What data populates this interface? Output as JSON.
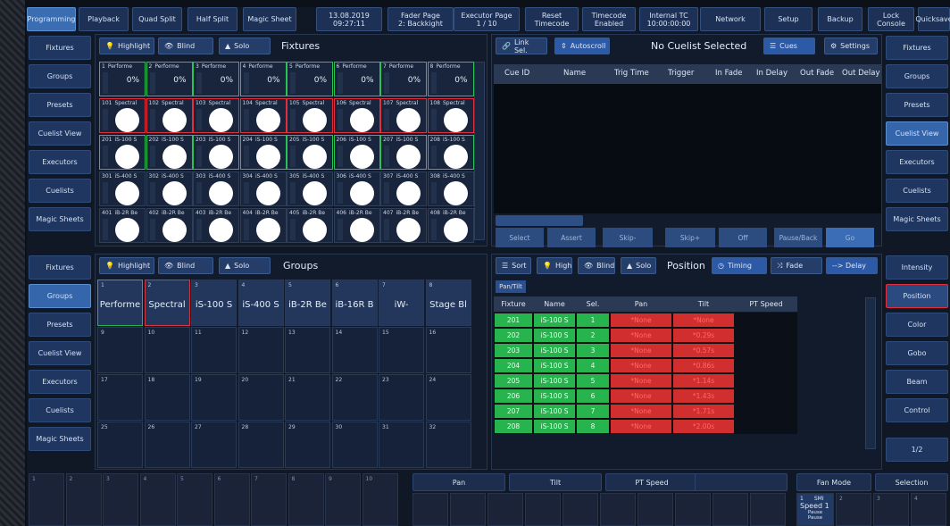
{
  "topbar": {
    "items": [
      "Programming",
      "Playback",
      "Quad Split",
      "Half Split",
      "Magic Sheet",
      "13.08.2019\n09:27:11",
      "Fader Page\n2: Backkight",
      "Executor Page\n1 / 10",
      "Reset\nTimecode",
      "Timecode\nEnabled",
      "Internal TC\n10:00:00:00",
      "Network",
      "Setup",
      "Backup",
      "Lock Console",
      "Quicksave"
    ]
  },
  "left_sidebar_top": [
    "Fixtures",
    "Groups",
    "Presets",
    "Cuelist View",
    "Executors",
    "Cuelists",
    "Magic Sheets"
  ],
  "left_sidebar_bottom": [
    "Fixtures",
    "Groups",
    "Presets",
    "Cuelist View",
    "Executors",
    "Cuelists",
    "Magic Sheets"
  ],
  "right_sidebar_top": [
    "Fixtures",
    "Groups",
    "Presets",
    "Cuelist View",
    "Executors",
    "Cuelists",
    "Magic Sheets"
  ],
  "right_sidebar_bottom": [
    "Intensity",
    "Position",
    "Color",
    "Gobo",
    "Beam",
    "Control",
    "1/2"
  ],
  "fixtures_panel": {
    "highlight": "Highlight",
    "blind": "Blind",
    "solo": "Solo",
    "title": "Fixtures",
    "row1": [
      {
        "n": "1",
        "name": "Performe",
        "pct": "0%"
      },
      {
        "n": "2",
        "name": "Performe",
        "pct": "0%"
      },
      {
        "n": "3",
        "name": "Performe",
        "pct": "0%"
      },
      {
        "n": "4",
        "name": "Performe",
        "pct": "0%"
      },
      {
        "n": "5",
        "name": "Performe",
        "pct": "0%"
      },
      {
        "n": "6",
        "name": "Performe",
        "pct": "0%"
      },
      {
        "n": "7",
        "name": "Performe",
        "pct": "0%"
      },
      {
        "n": "8",
        "name": "Performe",
        "pct": "0%"
      }
    ],
    "row2": [
      {
        "n": "101",
        "name": "Spectral"
      },
      {
        "n": "102",
        "name": "Spectral"
      },
      {
        "n": "103",
        "name": "Spectral"
      },
      {
        "n": "104",
        "name": "Spectral"
      },
      {
        "n": "105",
        "name": "Spectral"
      },
      {
        "n": "106",
        "name": "Spectral"
      },
      {
        "n": "107",
        "name": "Spectral"
      },
      {
        "n": "108",
        "name": "Spectral"
      }
    ],
    "row3": [
      {
        "n": "201",
        "name": "iS-100 S"
      },
      {
        "n": "202",
        "name": "iS-100 S"
      },
      {
        "n": "203",
        "name": "iS-100 S"
      },
      {
        "n": "204",
        "name": "iS-100 S"
      },
      {
        "n": "205",
        "name": "iS-100 S"
      },
      {
        "n": "206",
        "name": "iS-100 S"
      },
      {
        "n": "207",
        "name": "iS-100 S"
      },
      {
        "n": "208",
        "name": "iS-100 S"
      }
    ],
    "row4": [
      {
        "n": "301",
        "name": "iS-400 S"
      },
      {
        "n": "302",
        "name": "iS-400 S"
      },
      {
        "n": "303",
        "name": "iS-400 S"
      },
      {
        "n": "304",
        "name": "iS-400 S"
      },
      {
        "n": "305",
        "name": "iS-400 S"
      },
      {
        "n": "306",
        "name": "iS-400 S"
      },
      {
        "n": "307",
        "name": "iS-400 S"
      },
      {
        "n": "308",
        "name": "iS-400 S"
      }
    ],
    "row5": [
      {
        "n": "401",
        "name": "iB-2R Be"
      },
      {
        "n": "402",
        "name": "iB-2R Be"
      },
      {
        "n": "403",
        "name": "iB-2R Be"
      },
      {
        "n": "404",
        "name": "iB-2R Be"
      },
      {
        "n": "405",
        "name": "iB-2R Be"
      },
      {
        "n": "406",
        "name": "iB-2R Be"
      },
      {
        "n": "407",
        "name": "iB-2R Be"
      },
      {
        "n": "408",
        "name": "iB-2R Be"
      }
    ]
  },
  "cuelist_panel": {
    "link_sel": "Link Sel.",
    "autoscroll": "Autoscroll",
    "title": "No Cuelist Selected",
    "cues": "Cues",
    "settings": "Settings",
    "columns": [
      "Cue ID",
      "Name",
      "Trig Time",
      "Trigger",
      "In Fade",
      "In Delay",
      "Out Fade",
      "Out Delay"
    ],
    "controls": [
      "Select",
      "Assert",
      "Skip-",
      "Skip+",
      "Off",
      "Pause/Back",
      "Go"
    ]
  },
  "groups_panel": {
    "highlight": "Highlight",
    "blind": "Blind",
    "solo": "Solo",
    "title": "Groups",
    "cells": [
      {
        "n": "1",
        "name": "Performe"
      },
      {
        "n": "2",
        "name": "Spectral"
      },
      {
        "n": "3",
        "name": "iS-100 S"
      },
      {
        "n": "4",
        "name": "iS-400 S"
      },
      {
        "n": "5",
        "name": "iB-2R Be"
      },
      {
        "n": "6",
        "name": "iB-16R B"
      },
      {
        "n": "7",
        "name": "iW-"
      },
      {
        "n": "8",
        "name": "Stage Bl"
      },
      {
        "n": "9",
        "name": ""
      },
      {
        "n": "10",
        "name": ""
      },
      {
        "n": "11",
        "name": ""
      },
      {
        "n": "12",
        "name": ""
      },
      {
        "n": "13",
        "name": ""
      },
      {
        "n": "14",
        "name": ""
      },
      {
        "n": "15",
        "name": ""
      },
      {
        "n": "16",
        "name": ""
      },
      {
        "n": "17",
        "name": ""
      },
      {
        "n": "18",
        "name": ""
      },
      {
        "n": "19",
        "name": ""
      },
      {
        "n": "20",
        "name": ""
      },
      {
        "n": "21",
        "name": ""
      },
      {
        "n": "22",
        "name": ""
      },
      {
        "n": "23",
        "name": ""
      },
      {
        "n": "24",
        "name": ""
      },
      {
        "n": "25",
        "name": ""
      },
      {
        "n": "26",
        "name": ""
      },
      {
        "n": "27",
        "name": ""
      },
      {
        "n": "28",
        "name": ""
      },
      {
        "n": "29",
        "name": ""
      },
      {
        "n": "30",
        "name": ""
      },
      {
        "n": "31",
        "name": ""
      },
      {
        "n": "32",
        "name": ""
      }
    ]
  },
  "position_panel": {
    "sort": "Sort",
    "high": "High",
    "blind": "Blind",
    "solo": "Solo",
    "title": "Position",
    "timing": "Timing",
    "fade": "Fade",
    "delay": "--> Delay",
    "tab": "Pan/Tilt",
    "columns": [
      "Fixture",
      "Name",
      "Sel.",
      "Pan",
      "Tilt",
      "PT Speed"
    ],
    "rows": [
      [
        "201",
        "iS-100 S",
        "1",
        "*None",
        "*None"
      ],
      [
        "202",
        "iS-100 S",
        "2",
        "*None",
        "*0.29s"
      ],
      [
        "203",
        "iS-100 S",
        "3",
        "*None",
        "*0.57s"
      ],
      [
        "204",
        "iS-100 S",
        "4",
        "*None",
        "*0.86s"
      ],
      [
        "205",
        "iS-100 S",
        "5",
        "*None",
        "*1.14s"
      ],
      [
        "206",
        "iS-100 S",
        "6",
        "*None",
        "*1.43s"
      ],
      [
        "207",
        "iS-100 S",
        "7",
        "*None",
        "*1.71s"
      ],
      [
        "208",
        "iS-100 S",
        "8",
        "*None",
        "*2.00s"
      ]
    ]
  },
  "bottom": {
    "left_nums": [
      "1",
      "2",
      "3",
      "4",
      "5",
      "6",
      "7",
      "8",
      "9",
      "10"
    ],
    "encoders": [
      "Pan",
      "Tilt",
      "PT Speed",
      ""
    ],
    "fan_mode": "Fan Mode",
    "selection": "Selection",
    "speed_cell": {
      "n": "1",
      "tag": "SMI",
      "name": "Speed 1",
      "l1": "Pause",
      "l2": "Pause"
    },
    "right_nums": [
      "2",
      "3",
      "4"
    ]
  },
  "colors": {
    "accent": "#3b6db3",
    "green": "#2ab154",
    "red": "#d8353f"
  }
}
